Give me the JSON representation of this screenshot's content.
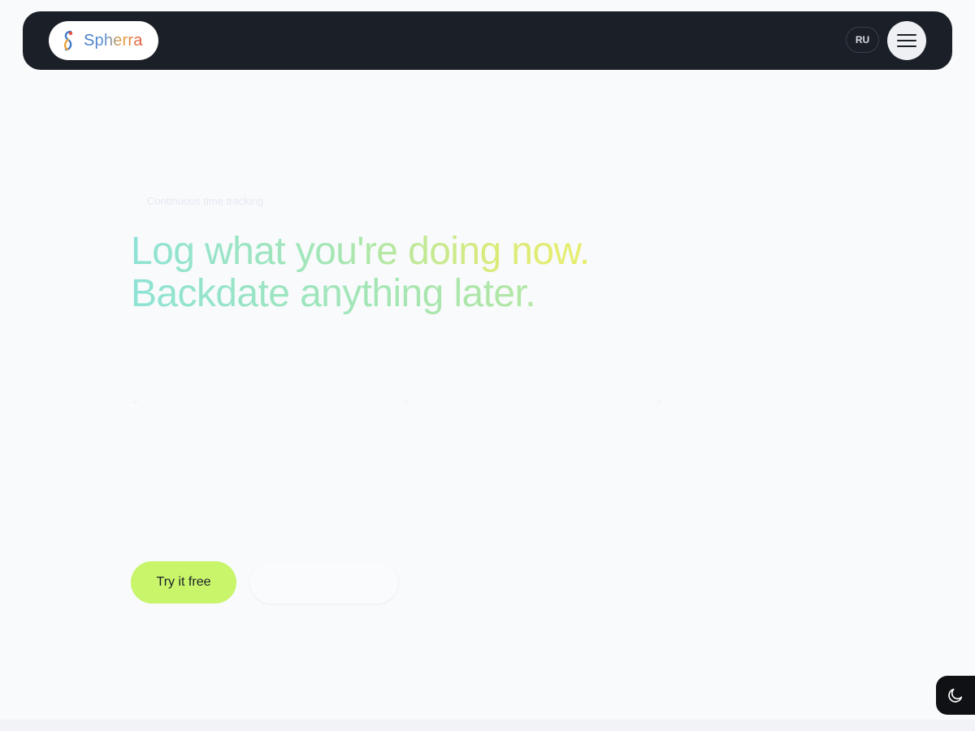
{
  "header": {
    "brand": "Spherra",
    "lang_label": "RU"
  },
  "hero": {
    "eyebrow": "Continuous time tracking",
    "title_line1": "Log what you're doing now.",
    "title_line2": "Backdate anything later."
  },
  "cta": {
    "primary_label": "Try it free"
  },
  "icons": {
    "logo": "spherra-logo-icon",
    "menu": "hamburger-menu-icon",
    "theme": "moon-icon",
    "check": "checkmark-icon"
  },
  "colors": {
    "topbar": "#1b1f27",
    "background": "#f8fafc",
    "primary_button": "#c8f56a",
    "headline_gradient_start": "#8ee3d5",
    "headline_gradient_end": "#e8ee6c"
  }
}
